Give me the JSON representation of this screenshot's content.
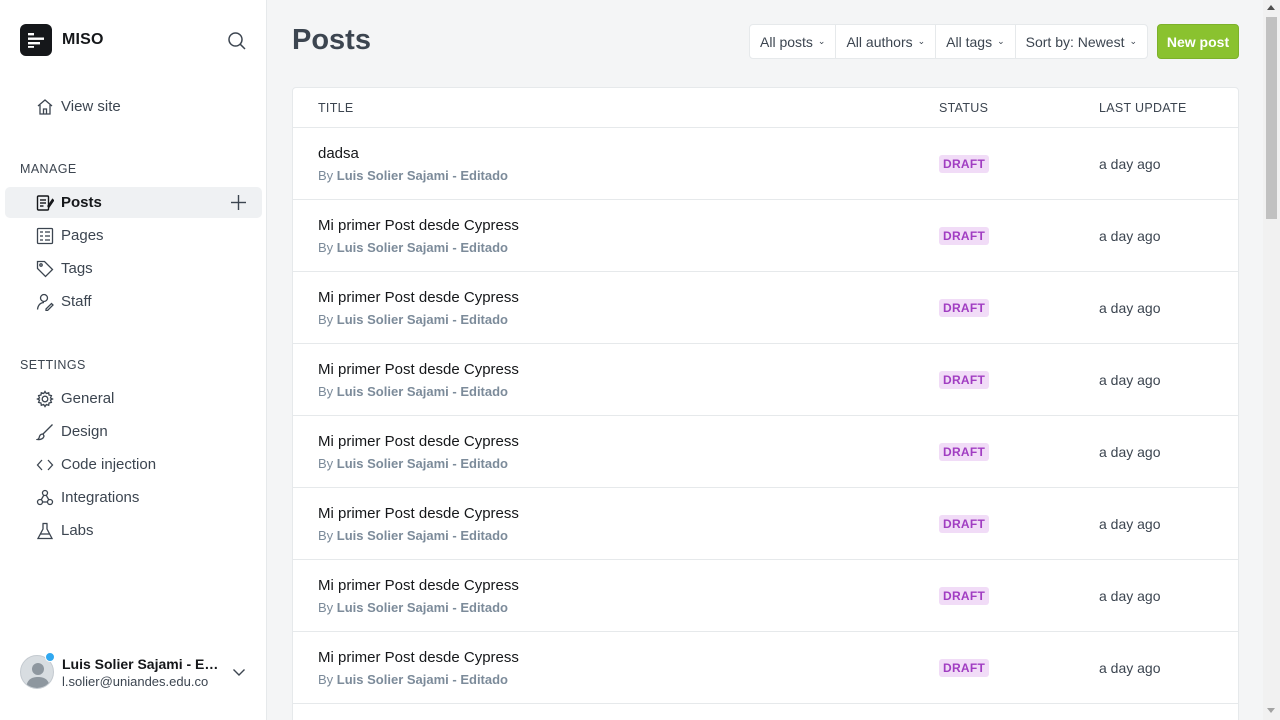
{
  "brand": {
    "name": "MISO"
  },
  "sidebar": {
    "view_site": "View site",
    "manage_title": "MANAGE",
    "manage_items": [
      {
        "label": "Posts",
        "icon": "posts-icon",
        "active": true
      },
      {
        "label": "Pages",
        "icon": "pages-icon"
      },
      {
        "label": "Tags",
        "icon": "tag-icon"
      },
      {
        "label": "Staff",
        "icon": "staff-icon"
      }
    ],
    "settings_title": "SETTINGS",
    "settings_items": [
      {
        "label": "General",
        "icon": "gear-icon"
      },
      {
        "label": "Design",
        "icon": "brush-icon"
      },
      {
        "label": "Code injection",
        "icon": "code-icon"
      },
      {
        "label": "Integrations",
        "icon": "integrations-icon"
      },
      {
        "label": "Labs",
        "icon": "flask-icon"
      }
    ]
  },
  "user": {
    "name": "Luis Solier Sajami - Editado",
    "email": "l.solier@uniandes.edu.co"
  },
  "header": {
    "title": "Posts",
    "filters": [
      "All posts",
      "All authors",
      "All tags",
      "Sort by: Newest"
    ],
    "new_post": "New post"
  },
  "table": {
    "columns": [
      "TITLE",
      "STATUS",
      "LAST UPDATE"
    ],
    "rows": [
      {
        "title": "dadsa",
        "by_prefix": "By",
        "author": "Luis Solier Sajami - Editado",
        "status": "DRAFT",
        "updated": "a day ago"
      },
      {
        "title": "Mi primer Post desde Cypress",
        "by_prefix": "By",
        "author": "Luis Solier Sajami - Editado",
        "status": "DRAFT",
        "updated": "a day ago"
      },
      {
        "title": "Mi primer Post desde Cypress",
        "by_prefix": "By",
        "author": "Luis Solier Sajami - Editado",
        "status": "DRAFT",
        "updated": "a day ago"
      },
      {
        "title": "Mi primer Post desde Cypress",
        "by_prefix": "By",
        "author": "Luis Solier Sajami - Editado",
        "status": "DRAFT",
        "updated": "a day ago"
      },
      {
        "title": "Mi primer Post desde Cypress",
        "by_prefix": "By",
        "author": "Luis Solier Sajami - Editado",
        "status": "DRAFT",
        "updated": "a day ago"
      },
      {
        "title": "Mi primer Post desde Cypress",
        "by_prefix": "By",
        "author": "Luis Solier Sajami - Editado",
        "status": "DRAFT",
        "updated": "a day ago"
      },
      {
        "title": "Mi primer Post desde Cypress",
        "by_prefix": "By",
        "author": "Luis Solier Sajami - Editado",
        "status": "DRAFT",
        "updated": "a day ago"
      },
      {
        "title": "Mi primer Post desde Cypress",
        "by_prefix": "By",
        "author": "Luis Solier Sajami - Editado",
        "status": "DRAFT",
        "updated": "a day ago"
      }
    ]
  },
  "colors": {
    "accent": "#8ac22f",
    "draft_bg": "#f1dcf7",
    "draft_text": "#a13dc2"
  }
}
